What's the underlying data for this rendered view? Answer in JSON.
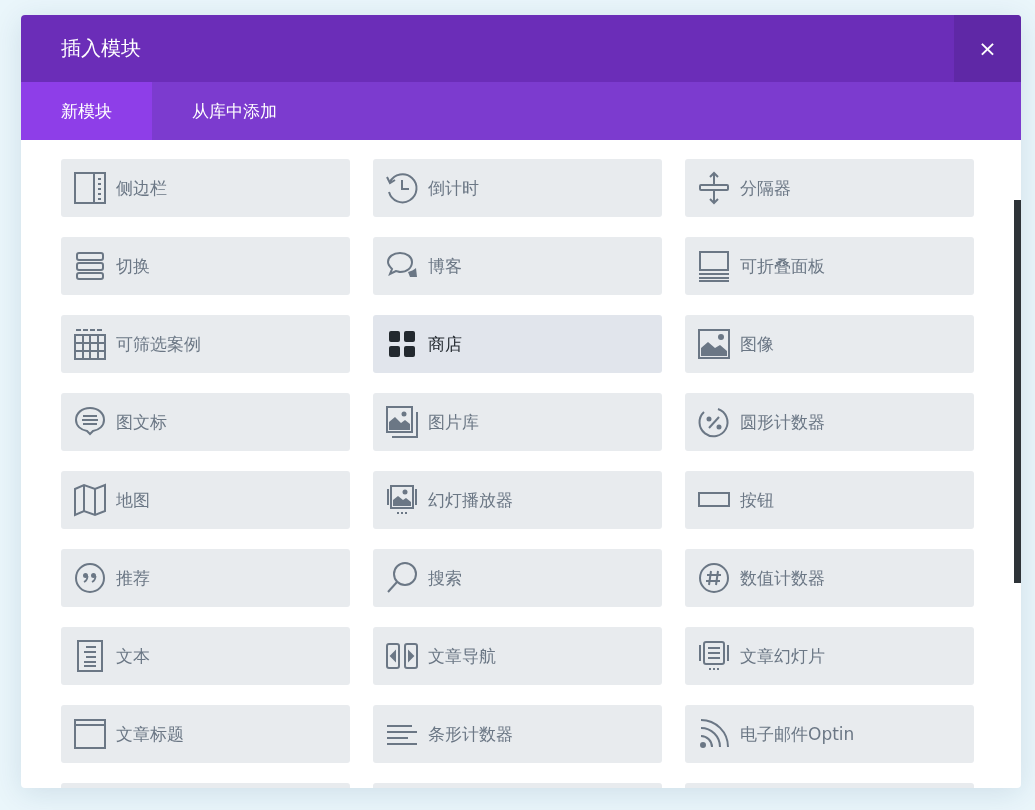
{
  "dialog": {
    "title": "插入模块",
    "close": "×"
  },
  "tabs": [
    {
      "label": "新模块",
      "selected": true
    },
    {
      "label": "从库中添加",
      "selected": false
    }
  ],
  "modules": [
    {
      "label": "侧边栏",
      "kind": "sidebar",
      "selected": false
    },
    {
      "label": "倒计时",
      "kind": "countdown",
      "selected": false
    },
    {
      "label": "分隔器",
      "kind": "divider",
      "selected": false
    },
    {
      "label": "切换",
      "kind": "toggle",
      "selected": false
    },
    {
      "label": "博客",
      "kind": "blog",
      "selected": false
    },
    {
      "label": "可折叠面板",
      "kind": "accordion",
      "selected": false
    },
    {
      "label": "可筛选案例",
      "kind": "portfolio",
      "selected": false
    },
    {
      "label": "商店",
      "kind": "shop",
      "selected": true
    },
    {
      "label": "图像",
      "kind": "image",
      "selected": false
    },
    {
      "label": "图文标",
      "kind": "blurb",
      "selected": false
    },
    {
      "label": "图片库",
      "kind": "gallery",
      "selected": false
    },
    {
      "label": "圆形计数器",
      "kind": "circle",
      "selected": false
    },
    {
      "label": "地图",
      "kind": "map",
      "selected": false
    },
    {
      "label": "幻灯播放器",
      "kind": "slider",
      "selected": false
    },
    {
      "label": "按钮",
      "kind": "button",
      "selected": false
    },
    {
      "label": "推荐",
      "kind": "quote",
      "selected": false
    },
    {
      "label": "搜索",
      "kind": "search",
      "selected": false
    },
    {
      "label": "数值计数器",
      "kind": "number",
      "selected": false
    },
    {
      "label": "文本",
      "kind": "text",
      "selected": false
    },
    {
      "label": "文章导航",
      "kind": "postnav",
      "selected": false
    },
    {
      "label": "文章幻灯片",
      "kind": "postslider",
      "selected": false
    },
    {
      "label": "文章标题",
      "kind": "posttitle",
      "selected": false
    },
    {
      "label": "条形计数器",
      "kind": "bars",
      "selected": false
    },
    {
      "label": "电子邮件Optin",
      "kind": "email",
      "selected": false
    }
  ]
}
